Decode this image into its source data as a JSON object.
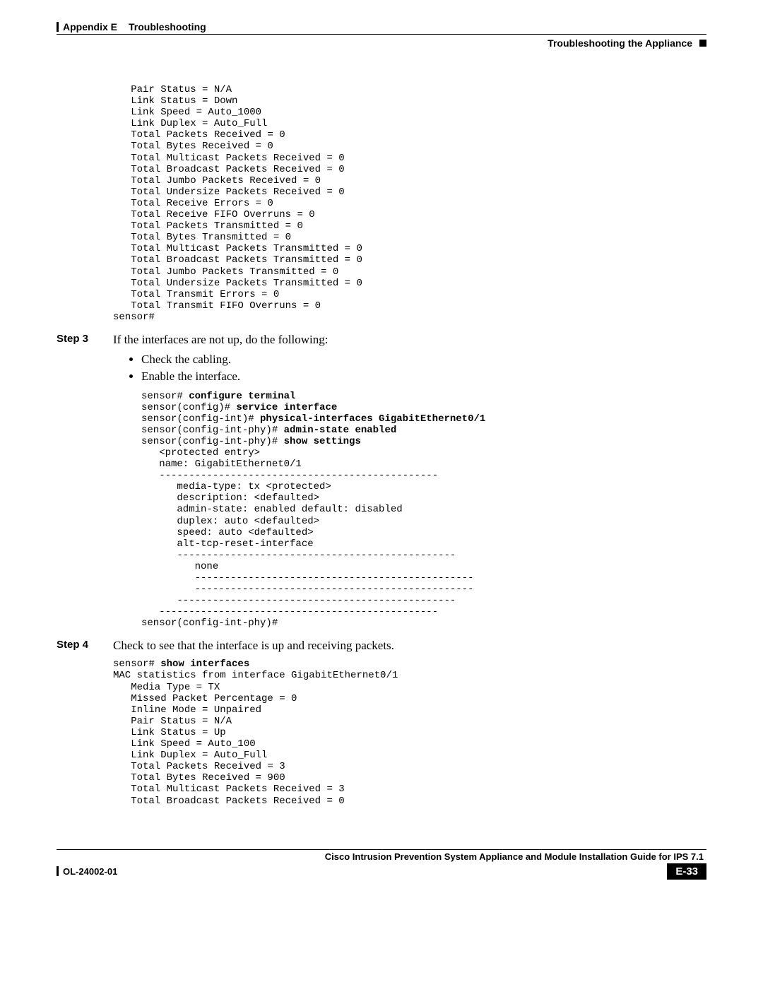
{
  "header": {
    "appendix": "Appendix E",
    "chapter": "Troubleshooting",
    "section": "Troubleshooting the Appliance"
  },
  "code1": "   Pair Status = N/A\n   Link Status = Down\n   Link Speed = Auto_1000\n   Link Duplex = Auto_Full\n   Total Packets Received = 0\n   Total Bytes Received = 0\n   Total Multicast Packets Received = 0\n   Total Broadcast Packets Received = 0\n   Total Jumbo Packets Received = 0\n   Total Undersize Packets Received = 0\n   Total Receive Errors = 0\n   Total Receive FIFO Overruns = 0\n   Total Packets Transmitted = 0\n   Total Bytes Transmitted = 0\n   Total Multicast Packets Transmitted = 0\n   Total Broadcast Packets Transmitted = 0\n   Total Jumbo Packets Transmitted = 0\n   Total Undersize Packets Transmitted = 0\n   Total Transmit Errors = 0\n   Total Transmit FIFO Overruns = 0\nsensor#",
  "step3": {
    "label": "Step 3",
    "text": "If the interfaces are not up, do the following:",
    "bullet1": "Check the cabling.",
    "bullet2": "Enable the interface."
  },
  "code2": {
    "l1a": "sensor# ",
    "l1b": "configure terminal",
    "l2a": "sensor(config)# ",
    "l2b": "service interface",
    "l3a": "sensor(config-int)# ",
    "l3b": "physical-interfaces GigabitEthernet0/1",
    "l4a": "sensor(config-int-phy)# ",
    "l4b": "admin-state enabled",
    "l5a": "sensor(config-int-phy)# ",
    "l5b": "show settings",
    "rest": "   <protected entry>\n   name: GigabitEthernet0/1\n   -----------------------------------------------\n      media-type: tx <protected>\n      description: <defaulted>\n      admin-state: enabled default: disabled\n      duplex: auto <defaulted>\n      speed: auto <defaulted>\n      alt-tcp-reset-interface\n      -----------------------------------------------\n         none\n         -----------------------------------------------\n         -----------------------------------------------\n      -----------------------------------------------\n   -----------------------------------------------\nsensor(config-int-phy)#"
  },
  "step4": {
    "label": "Step 4",
    "text": "Check to see that the interface is up and receiving packets."
  },
  "code3": {
    "l1a": "sensor# ",
    "l1b": "show interfaces",
    "rest": "MAC statistics from interface GigabitEthernet0/1\n   Media Type = TX\n   Missed Packet Percentage = 0\n   Inline Mode = Unpaired\n   Pair Status = N/A\n   Link Status = Up\n   Link Speed = Auto_100\n   Link Duplex = Auto_Full\n   Total Packets Received = 3\n   Total Bytes Received = 900\n   Total Multicast Packets Received = 3\n   Total Broadcast Packets Received = 0"
  },
  "footer": {
    "title": "Cisco Intrusion Prevention System Appliance and Module Installation Guide for IPS 7.1",
    "docnum": "OL-24002-01",
    "pagenum": "E-33"
  }
}
